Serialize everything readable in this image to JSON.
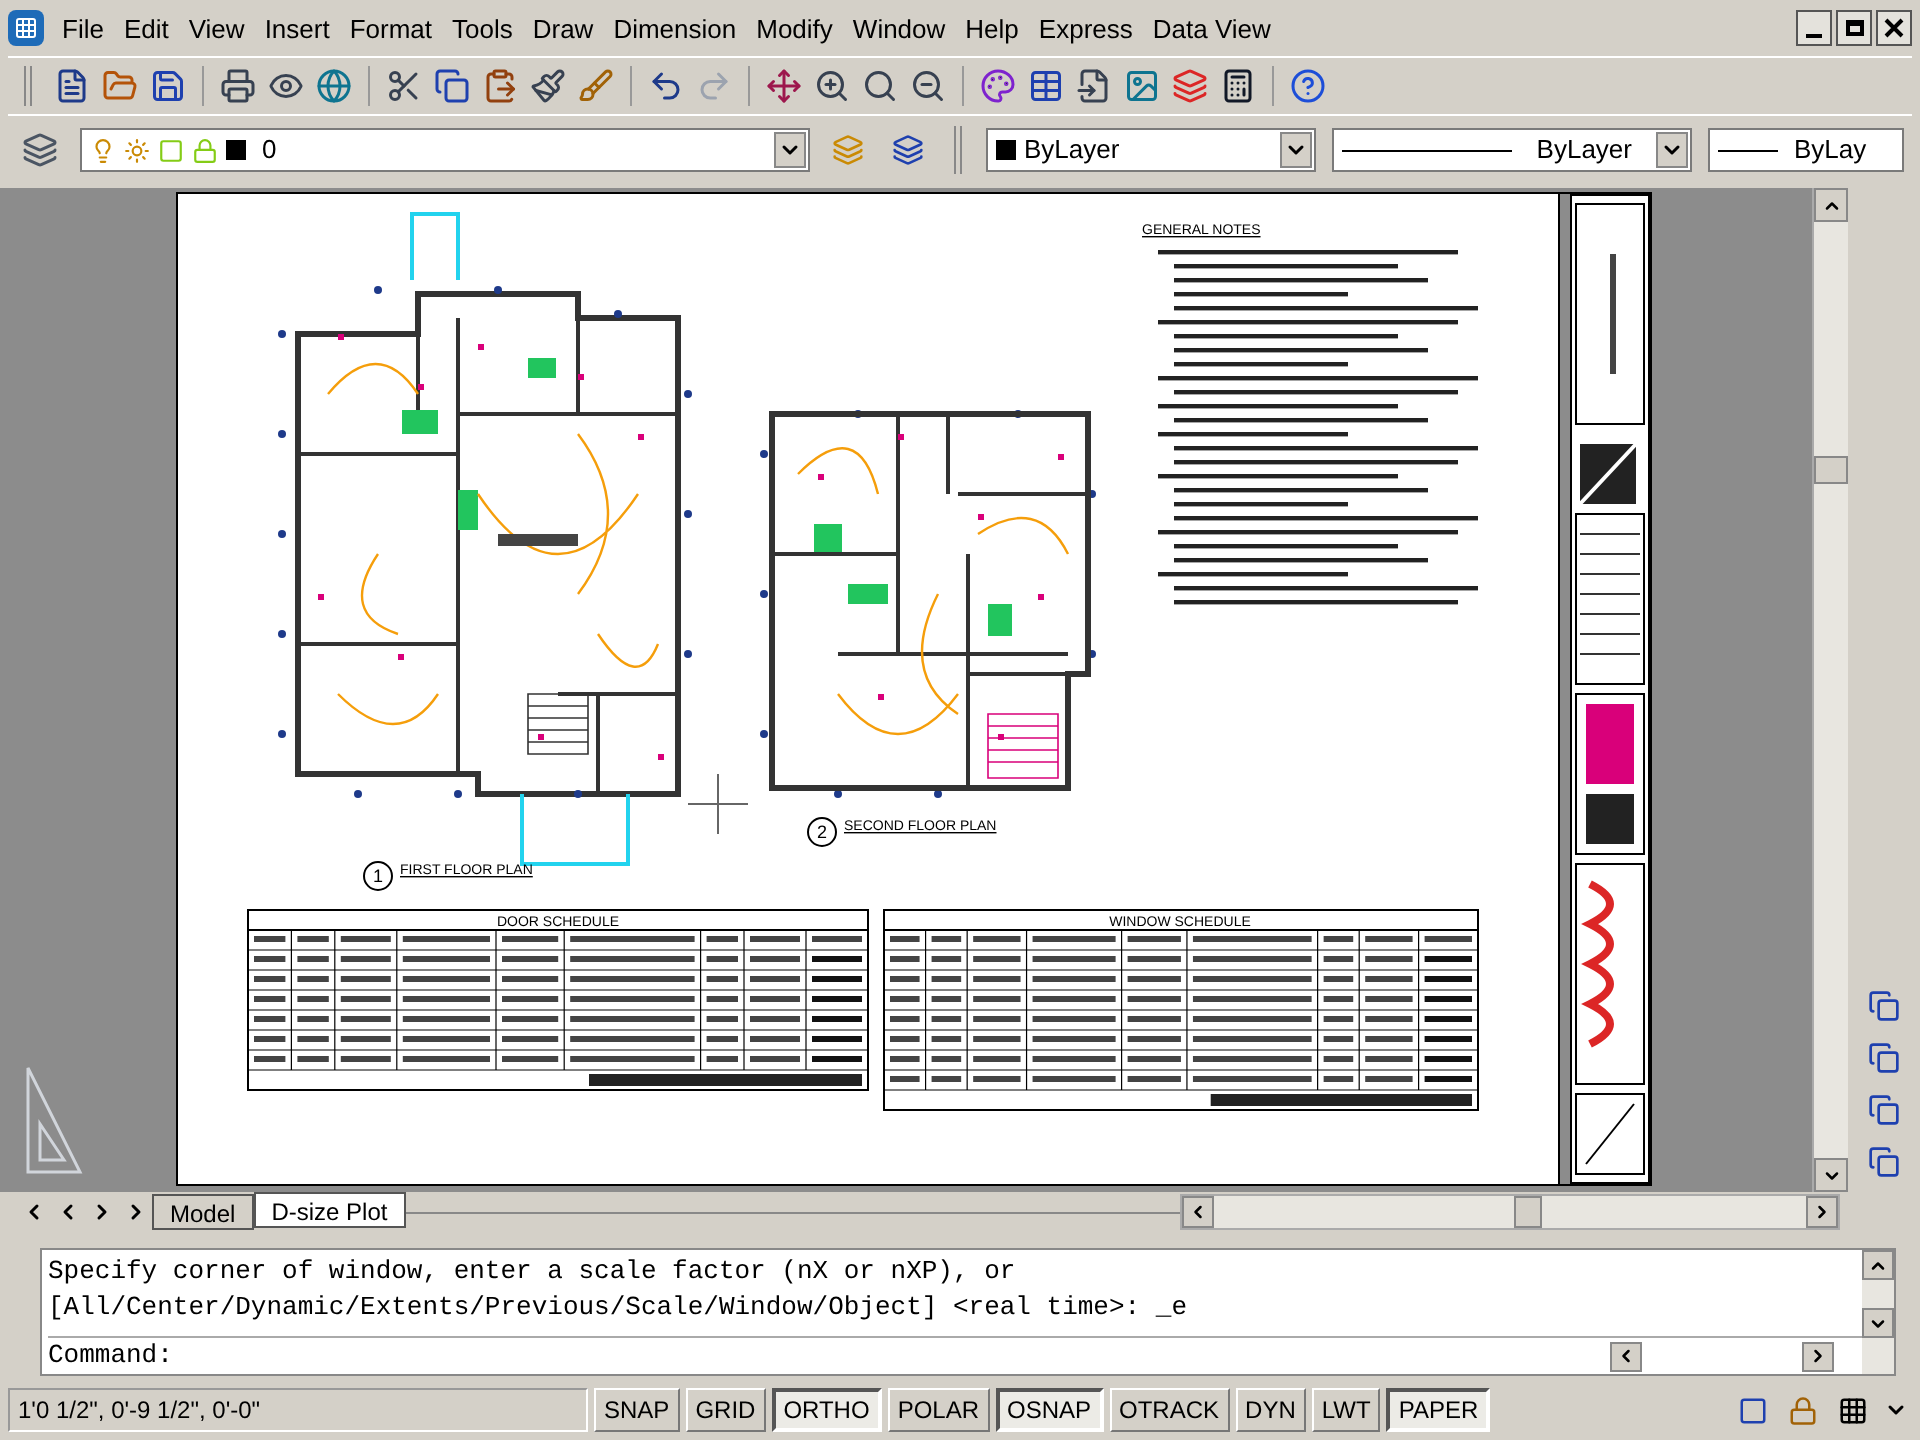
{
  "menu": [
    "File",
    "Edit",
    "View",
    "Insert",
    "Format",
    "Tools",
    "Draw",
    "Dimension",
    "Modify",
    "Window",
    "Help",
    "Express",
    "Data View"
  ],
  "layer_bar": {
    "layer": "0",
    "color_control": "ByLayer",
    "linetype": "ByLayer",
    "lineweight": "ByLay"
  },
  "drawing": {
    "notes_title": "GENERAL NOTES",
    "plans": [
      {
        "number": "1",
        "title": "FIRST FLOOR PLAN"
      },
      {
        "number": "2",
        "title": "SECOND FLOOR PLAN"
      }
    ],
    "schedules": [
      "DOOR SCHEDULE",
      "WINDOW SCHEDULE"
    ]
  },
  "layout_tabs": [
    {
      "label": "Model",
      "selected": false
    },
    {
      "label": "D-size Plot",
      "selected": true
    }
  ],
  "command_lines": [
    "Specify corner of window, enter a scale factor (nX or nXP), or",
    "[All/Center/Dynamic/Extents/Previous/Scale/Window/Object] <real time>: _e"
  ],
  "command_prompt": "Command:",
  "status_bar": {
    "coordinates": "1'0 1/2\", 0'-9 1/2\", 0'-0\"",
    "toggles": [
      {
        "label": "SNAP",
        "on": false
      },
      {
        "label": "GRID",
        "on": false
      },
      {
        "label": "ORTHO",
        "on": true
      },
      {
        "label": "POLAR",
        "on": false
      },
      {
        "label": "OSNAP",
        "on": true
      },
      {
        "label": "OTRACK",
        "on": false
      },
      {
        "label": "DYN",
        "on": false
      },
      {
        "label": "LWT",
        "on": false
      },
      {
        "label": "PAPER",
        "on": true
      }
    ]
  }
}
